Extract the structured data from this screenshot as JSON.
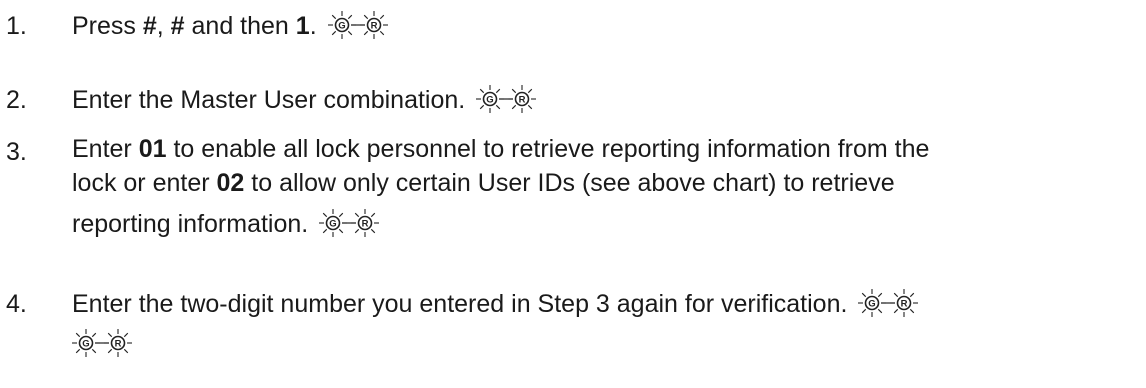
{
  "steps": [
    {
      "number": "1.",
      "parts": {
        "a": "Press ",
        "b": "#",
        "c": ", ",
        "d": "#",
        "e": " and then ",
        "f": "1",
        "g": "."
      }
    },
    {
      "number": "2.",
      "parts": {
        "a": "Enter the Master User combination."
      }
    },
    {
      "number": "3.",
      "parts": {
        "a": "Enter ",
        "b": "01",
        "c": " to enable all lock personnel to retrieve reporting information from the",
        "d": "lock or enter ",
        "e": "02",
        "f": " to allow only certain User IDs (see above chart) to retrieve",
        "g": "reporting information."
      }
    },
    {
      "number": "4.",
      "parts": {
        "a": "Enter the two-digit number you entered in Step 3 again for verification."
      }
    }
  ],
  "led": {
    "green_letter": "G",
    "red_letter": "R",
    "icon": "flashing-led-icon"
  }
}
